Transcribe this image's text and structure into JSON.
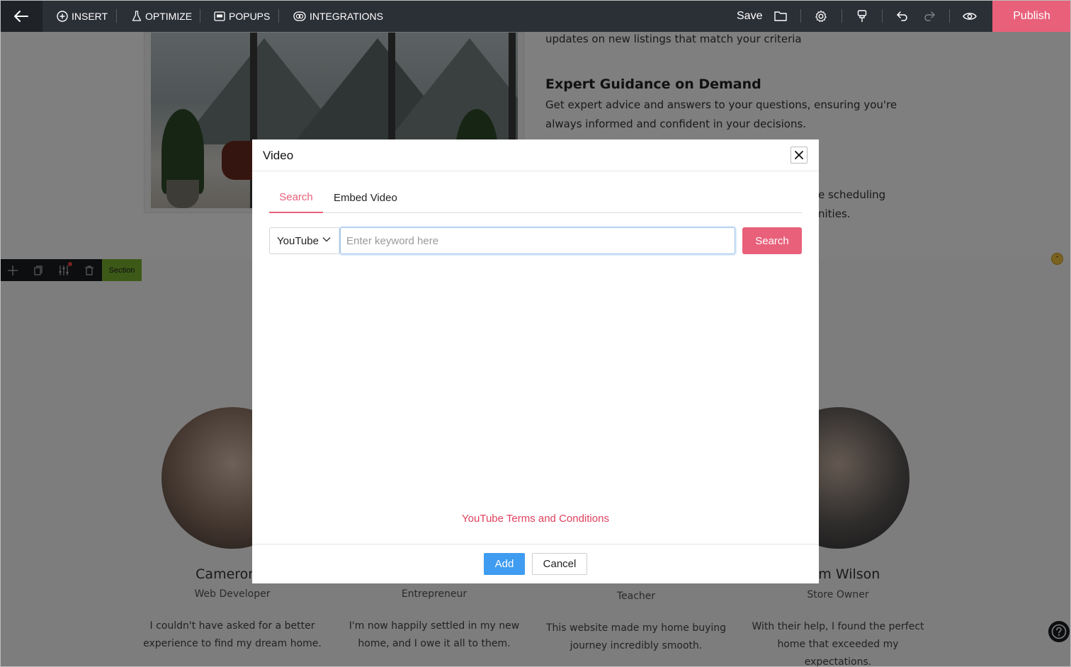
{
  "toolbar": {
    "insert_label": "INSERT",
    "optimize_label": "OPTIMIZE",
    "popups_label": "POPUPS",
    "integrations_label": "INTEGRATIONS",
    "save_label": "Save",
    "publish_label": "Publish"
  },
  "page": {
    "feature_partial_line": "updates on new listings that match your criteria",
    "feature_heading": "Expert Guidance on Demand",
    "feature_text_line1": "Get expert advice and answers to your questions, ensuring you're",
    "feature_text_line2": "always informed and confident in your decisions.",
    "partial_text_1": "e scheduling",
    "partial_text_2": "nities.",
    "section_label": "Section",
    "testimonials": [
      {
        "name": "Cameron P",
        "role": "Web Developer",
        "quote_line1": "I couldn't have asked for a better",
        "quote_line2": "experience to find my dream home."
      },
      {
        "name": "",
        "role": "Entrepreneur",
        "quote_line1": "I'm now happily settled in my new",
        "quote_line2": "home, and I owe it all to them."
      },
      {
        "name": "",
        "role": "Teacher",
        "quote_line1": "This website made my home buying",
        "quote_line2": "journey incredibly smooth."
      },
      {
        "name": "am Wilson",
        "role": "Store Owner",
        "quote_line1": "With their help, I found the perfect",
        "quote_line2": "home that exceeded my expectations."
      }
    ]
  },
  "modal": {
    "title": "Video",
    "tabs": [
      {
        "label": "Search",
        "active": true
      },
      {
        "label": "Embed Video",
        "active": false
      }
    ],
    "source_selected": "YouTube",
    "keyword_placeholder": "Enter keyword here",
    "keyword_value": "",
    "search_button": "Search",
    "terms_link": "YouTube Terms and Conditions",
    "add_button": "Add",
    "cancel_button": "Cancel"
  },
  "colors": {
    "toolbar_bg": "#2b2f36",
    "accent_pink": "#e8607a",
    "add_blue": "#3f9cf0",
    "section_green": "#7bb32e"
  },
  "icons": [
    "back-arrow-icon",
    "plus-circle-icon",
    "flask-icon",
    "popup-window-icon",
    "integrations-icon",
    "folder-icon",
    "gear-icon",
    "paint-brush-icon",
    "undo-icon",
    "redo-icon",
    "eye-icon",
    "move-icon",
    "copy-icon",
    "sliders-icon",
    "trash-icon",
    "chevron-down-icon",
    "close-icon",
    "help-icon"
  ]
}
